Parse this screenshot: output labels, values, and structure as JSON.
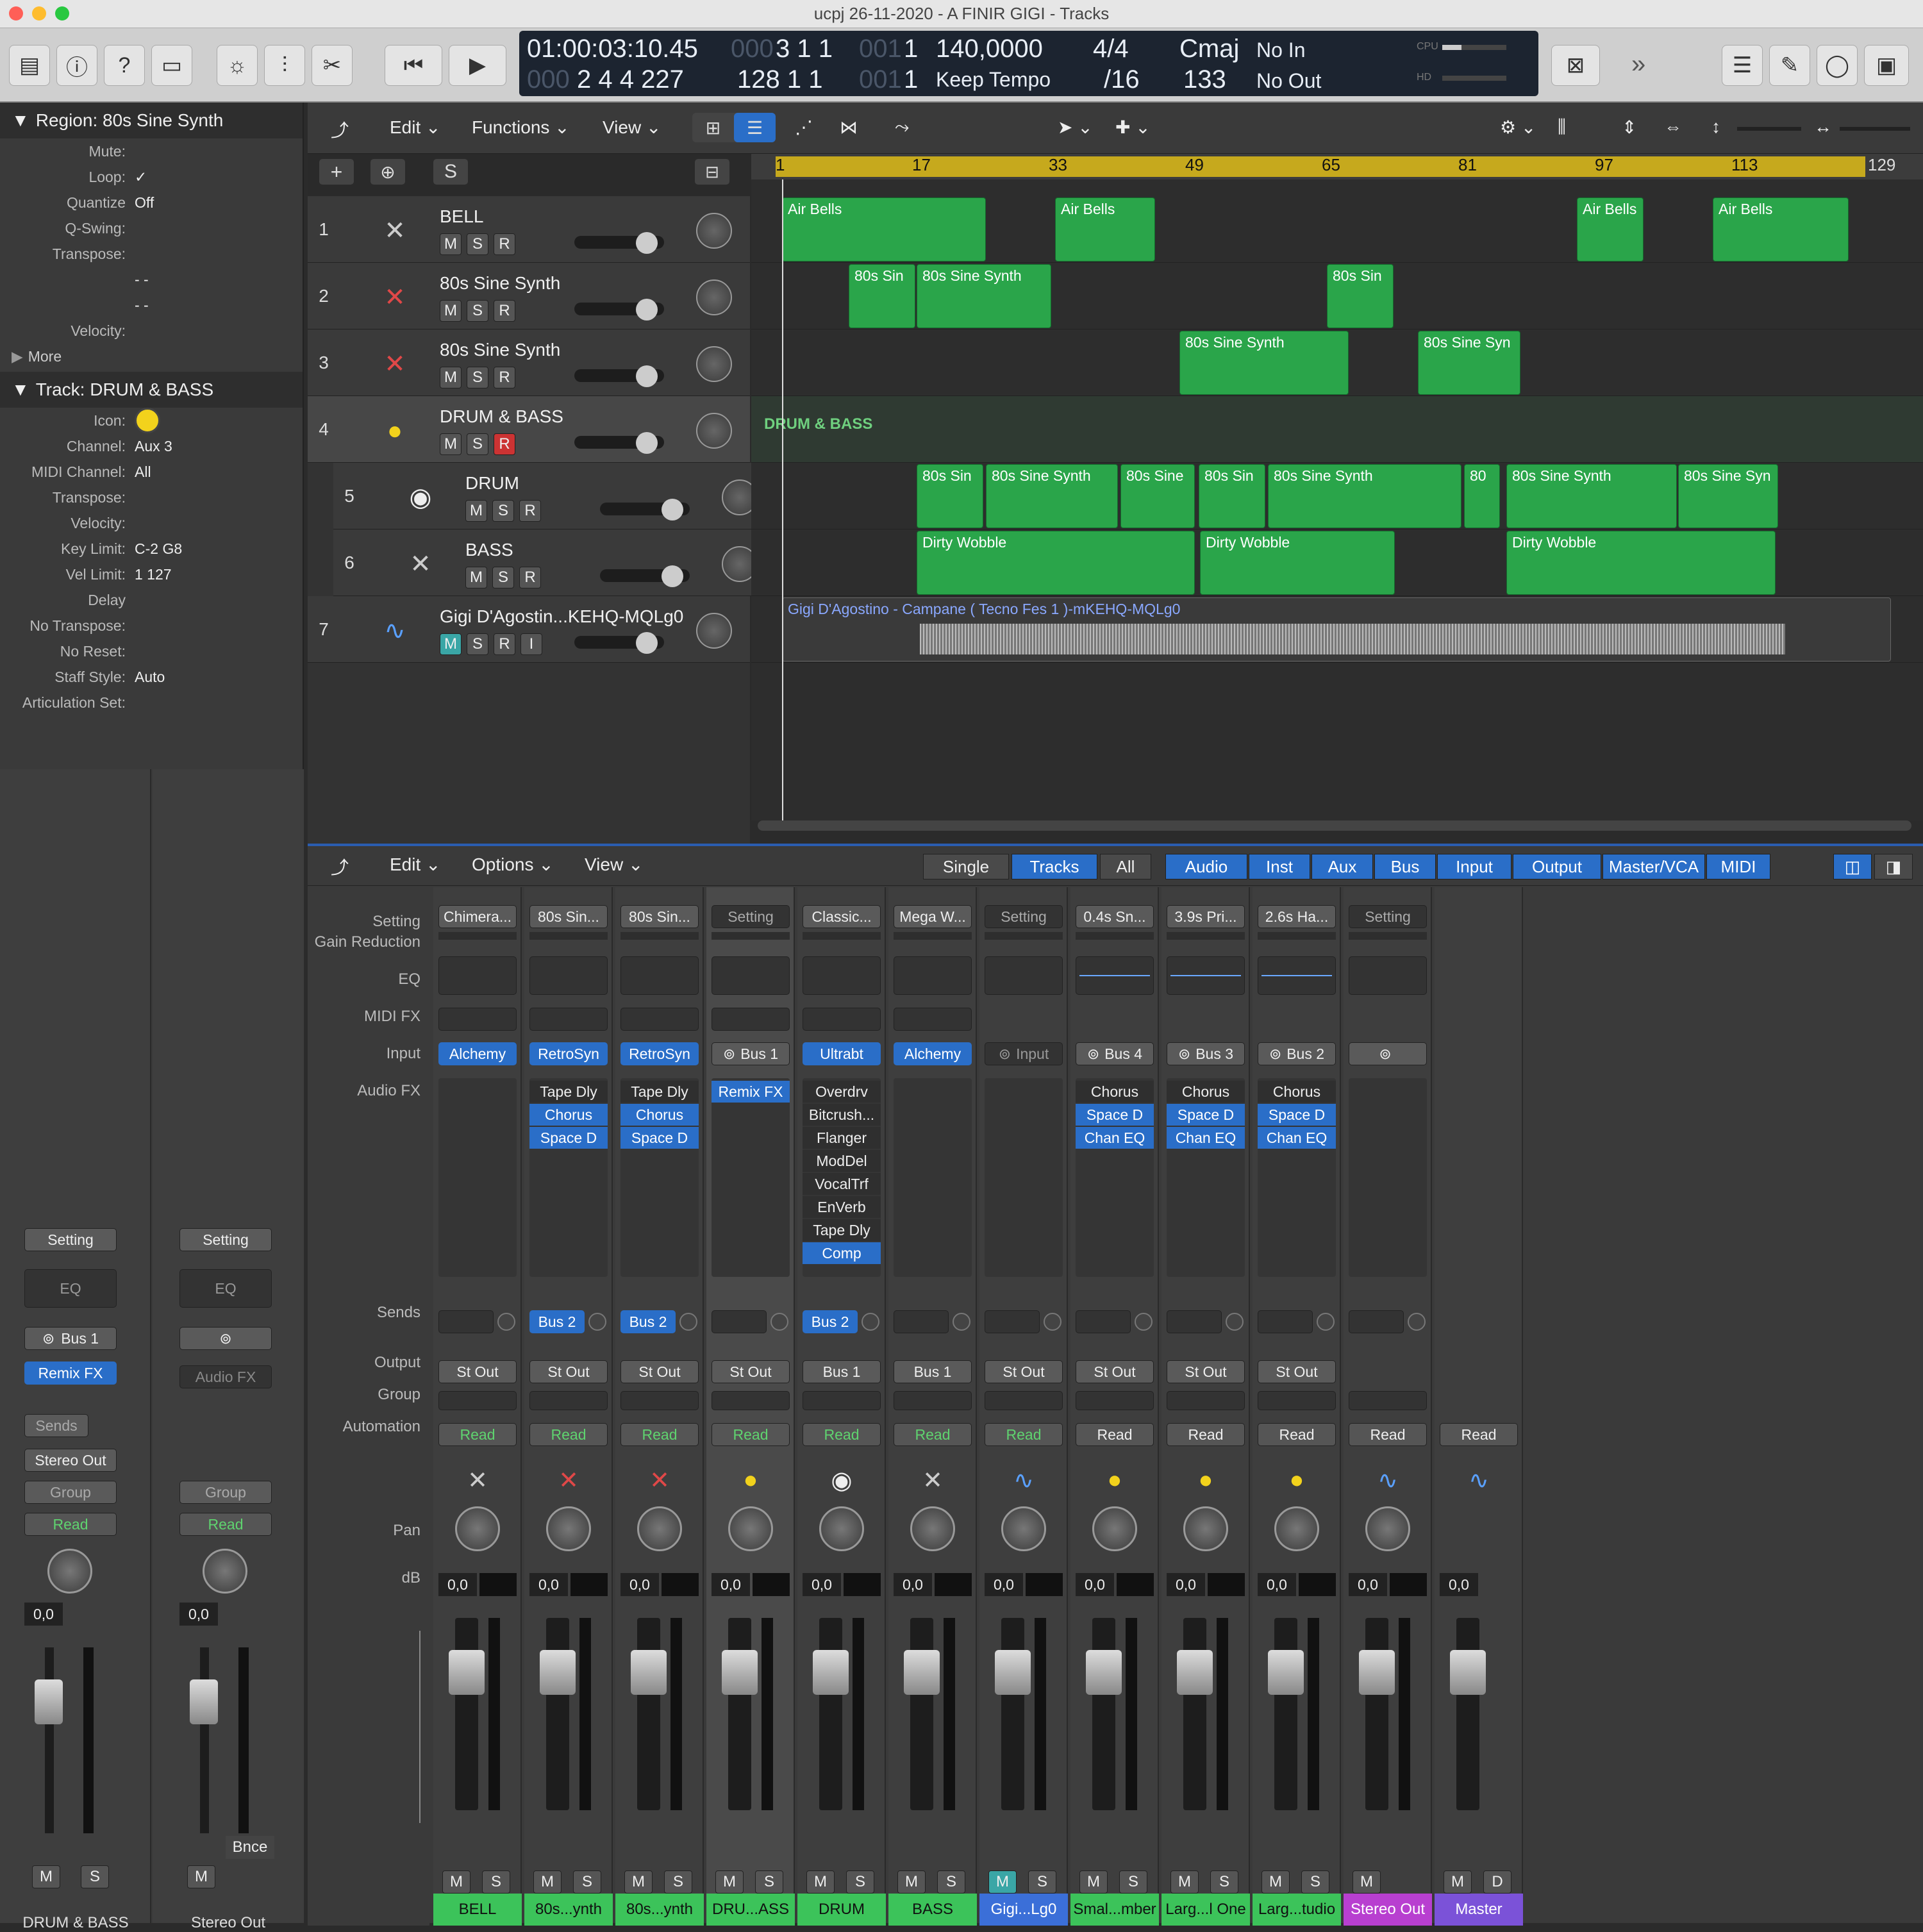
{
  "window": {
    "title": "ucpj 26-11-2020 - A FINIR GIGI - Tracks"
  },
  "lcd": {
    "smpte": "01:00:03:10.45",
    "smpte_dim": "000",
    "bars_top": "3  1  1",
    "bars_top_dim": "001",
    "bars_top2": "1",
    "bars_bottom_dim": "000",
    "bars_bottom": "2  4  4  227",
    "len": "128  1  1",
    "len_dim": "001",
    "len2": "1",
    "tempo": "140,0000",
    "tempo_mode": "Keep Tempo",
    "sig": "4/4",
    "div": "/16",
    "key": "Cmaj",
    "key2": "133",
    "midi_in": "No In",
    "midi_out": "No Out",
    "cpu": "CPU",
    "hd": "HD"
  },
  "inspector": {
    "region_header": "Region: 80s Sine Synth",
    "region_rows": [
      {
        "label": "Mute:",
        "value": ""
      },
      {
        "label": "Loop:",
        "value": "✓"
      },
      {
        "label": "Quantize",
        "value": "Off"
      },
      {
        "label": "Q-Swing:",
        "value": ""
      },
      {
        "label": "Transpose:",
        "value": ""
      },
      {
        "label": "",
        "value": "- -"
      },
      {
        "label": "",
        "value": "- -"
      },
      {
        "label": "Velocity:",
        "value": ""
      }
    ],
    "more": "More",
    "track_header": "Track:  DRUM & BASS",
    "track_rows": [
      {
        "label": "Icon:",
        "value": ""
      },
      {
        "label": "Channel:",
        "value": "Aux 3"
      },
      {
        "label": "MIDI Channel:",
        "value": "All"
      },
      {
        "label": "Transpose:",
        "value": ""
      },
      {
        "label": "Velocity:",
        "value": ""
      },
      {
        "label": "Key Limit:",
        "value": "C-2  G8"
      },
      {
        "label": "Vel Limit:",
        "value": "1  127"
      },
      {
        "label": "Delay",
        "value": ""
      },
      {
        "label": "No Transpose:",
        "value": ""
      },
      {
        "label": "No Reset:",
        "value": ""
      },
      {
        "label": "Staff Style:",
        "value": "Auto"
      },
      {
        "label": "Articulation Set:",
        "value": ""
      }
    ],
    "strip1": {
      "setting": "Setting",
      "eq": "EQ",
      "input": "Bus 1",
      "fx": "Remix FX",
      "sends": "Sends",
      "output": "Stereo Out",
      "group": "Group",
      "auto": "Read",
      "db": "0,0",
      "m": "M",
      "s": "S",
      "name": "DRUM & BASS"
    },
    "strip2": {
      "setting": "Setting",
      "eq": "EQ",
      "input": "",
      "fx": "Audio FX",
      "group": "Group",
      "auto": "Read",
      "db": "0,0",
      "m": "M",
      "bnce": "Bnce",
      "name": "Stereo Out"
    }
  },
  "tracks_toolbar": {
    "edit": "Edit",
    "functions": "Functions",
    "view": "View",
    "s": "S"
  },
  "ruler": [
    "1",
    "17",
    "33",
    "49",
    "65",
    "81",
    "97",
    "113",
    "129"
  ],
  "tracks": [
    {
      "num": "1",
      "name": "BELL",
      "m": "M",
      "s": "S",
      "r": "R",
      "icon": "keyboard-icon"
    },
    {
      "num": "2",
      "name": "80s Sine Synth",
      "m": "M",
      "s": "S",
      "r": "R",
      "icon": "synth-icon"
    },
    {
      "num": "3",
      "name": "80s Sine Synth",
      "m": "M",
      "s": "S",
      "r": "R",
      "icon": "synth-icon"
    },
    {
      "num": "4",
      "name": "DRUM & BASS",
      "m": "M",
      "s": "S",
      "r": "R",
      "icon": "stack-icon"
    },
    {
      "num": "5",
      "name": "DRUM",
      "m": "M",
      "s": "S",
      "r": "R",
      "icon": "drum-icon"
    },
    {
      "num": "6",
      "name": "BASS",
      "m": "M",
      "s": "S",
      "r": "R",
      "icon": "keyboard-icon"
    },
    {
      "num": "7",
      "name": "Gigi D'Agostin...KEHQ-MQLg0",
      "m": "M",
      "s": "S",
      "r": "R",
      "i": "I",
      "icon": "waveform-icon"
    }
  ],
  "regions": {
    "stack_label": "DRUM & BASS",
    "audio_label": "Gigi D'Agostino - Campane ( Tecno Fes 1 )-mKEHQ-MQLg0",
    "r": [
      {
        "lane": 0,
        "text": "Air Bells"
      },
      {
        "lane": 0,
        "text": "Air Bells"
      },
      {
        "lane": 0,
        "text": "Air Bells"
      },
      {
        "lane": 0,
        "text": "Air Bells"
      },
      {
        "lane": 1,
        "text": "80s Sin"
      },
      {
        "lane": 1,
        "text": "80s Sine Synth"
      },
      {
        "lane": 1,
        "text": "80s Sin"
      },
      {
        "lane": 2,
        "text": "80s Sine Synth"
      },
      {
        "lane": 2,
        "text": "80s Sine Syn"
      },
      {
        "lane": 4,
        "text": "80s Sin"
      },
      {
        "lane": 4,
        "text": "80s Sine Synth"
      },
      {
        "lane": 4,
        "text": "80s Sine"
      },
      {
        "lane": 4,
        "text": "80s Sin"
      },
      {
        "lane": 4,
        "text": "80s Sine Synth"
      },
      {
        "lane": 4,
        "text": "80"
      },
      {
        "lane": 4,
        "text": "80s Sine Synth"
      },
      {
        "lane": 4,
        "text": "80s Sine Syn"
      },
      {
        "lane": 5,
        "text": "Dirty Wobble"
      },
      {
        "lane": 5,
        "text": "Dirty Wobble"
      },
      {
        "lane": 5,
        "text": "Dirty Wobble"
      }
    ]
  },
  "mixer_toolbar": {
    "edit": "Edit",
    "options": "Options",
    "view": "View",
    "tabs": [
      "Single",
      "Tracks",
      "All"
    ],
    "filters": [
      "Audio",
      "Inst",
      "Aux",
      "Bus",
      "Input",
      "Output",
      "Master/VCA",
      "MIDI"
    ]
  },
  "mixer_labels": [
    "Setting",
    "Gain Reduction",
    "EQ",
    "MIDI FX",
    "Input",
    "Audio FX",
    "Sends",
    "Output",
    "Group",
    "Automation",
    "Pan",
    "dB"
  ],
  "strips": [
    {
      "setting": "Chimera...",
      "input": "Alchemy",
      "fx": [],
      "send": "",
      "output": "St Out",
      "auto": "Read",
      "db": "0,0",
      "name": "BELL",
      "color": "#3cc35a",
      "icon": "keyboard-icon",
      "ms": [
        "M",
        "S"
      ]
    },
    {
      "setting": "80s Sin...",
      "input": "RetroSyn",
      "fx": [
        "Tape Dly",
        "Chorus",
        "Space D"
      ],
      "send": "Bus 2",
      "output": "St Out",
      "auto": "Read",
      "db": "0,0",
      "name": "80s...ynth",
      "color": "#3cc35a",
      "icon": "synth-icon",
      "ms": [
        "M",
        "S"
      ]
    },
    {
      "setting": "80s Sin...",
      "input": "RetroSyn",
      "fx": [
        "Tape Dly",
        "Chorus",
        "Space D"
      ],
      "send": "Bus 2",
      "output": "St Out",
      "auto": "Read",
      "db": "0,0",
      "name": "80s...ynth",
      "color": "#3cc35a",
      "icon": "synth-icon",
      "ms": [
        "M",
        "S"
      ]
    },
    {
      "setting": "Setting",
      "input": "Bus 1",
      "fx": [
        "Remix FX"
      ],
      "send": "",
      "output": "St Out",
      "auto": "Read",
      "db": "0,0",
      "name": "DRU...ASS",
      "color": "#3cc35a",
      "icon": "stack-icon",
      "ms": [
        "M",
        "S"
      ]
    },
    {
      "setting": "Classic...",
      "input": "Ultrabt",
      "fx": [
        "Overdrv",
        "Bitcrush...",
        "Flanger",
        "ModDel",
        "VocalTrf",
        "EnVerb",
        "Tape Dly",
        "Comp"
      ],
      "send": "Bus 2",
      "output": "Bus 1",
      "auto": "Read",
      "db": "0,0",
      "name": "DRUM",
      "color": "#3cc35a",
      "icon": "drum-icon",
      "ms": [
        "M",
        "S"
      ]
    },
    {
      "setting": "Mega W...",
      "input": "Alchemy",
      "fx": [],
      "send": "",
      "output": "Bus 1",
      "auto": "Read",
      "db": "0,0",
      "name": "BASS",
      "color": "#3cc35a",
      "icon": "keyboard-icon",
      "ms": [
        "M",
        "S"
      ]
    },
    {
      "setting": "Setting",
      "input": "Input",
      "fx": [],
      "send": "",
      "output": "St Out",
      "auto": "Read",
      "db": "0,0",
      "name": "Gigi...Lg0",
      "color": "#3b6fd8",
      "icon": "waveform-icon",
      "ms": [
        "M",
        "S"
      ]
    },
    {
      "setting": "0.4s Sn...",
      "input": "Bus 4",
      "fx": [
        "Chorus",
        "Space D",
        "Chan EQ"
      ],
      "send": "",
      "output": "St Out",
      "auto": "Read",
      "db": "0,0",
      "name": "Smal...mber",
      "color": "#3cc35a",
      "icon": "stack-icon",
      "ms": [
        "M",
        "S"
      ]
    },
    {
      "setting": "3.9s Pri...",
      "input": "Bus 3",
      "fx": [
        "Chorus",
        "Space D",
        "Chan EQ"
      ],
      "send": "",
      "output": "St Out",
      "auto": "Read",
      "db": "0,0",
      "name": "Larg...l One",
      "color": "#3cc35a",
      "icon": "stack-icon",
      "ms": [
        "M",
        "S"
      ]
    },
    {
      "setting": "2.6s Ha...",
      "input": "Bus 2",
      "fx": [
        "Chorus",
        "Space D",
        "Chan EQ"
      ],
      "send": "",
      "output": "St Out",
      "auto": "Read",
      "db": "0,0",
      "name": "Larg...tudio",
      "color": "#3cc35a",
      "icon": "stack-icon",
      "ms": [
        "M",
        "S"
      ]
    },
    {
      "setting": "Setting",
      "input": "",
      "fx": [],
      "send": "",
      "output": "",
      "auto": "Read",
      "db": "0,0",
      "name": "Stereo Out",
      "color": "#b83fd0",
      "icon": "waveform-icon",
      "ms": [
        "M"
      ]
    },
    {
      "setting": "",
      "input": "",
      "fx": [],
      "send": "",
      "output": "",
      "auto": "Read",
      "db": "0,0",
      "name": "Master",
      "color": "#7b52d8",
      "icon": "waveform-icon",
      "ms": [
        "M",
        "D"
      ]
    }
  ],
  "colors": {
    "region": "#2aa54a",
    "cycle": "#c6a91d",
    "accent": "#2a6ec8"
  }
}
